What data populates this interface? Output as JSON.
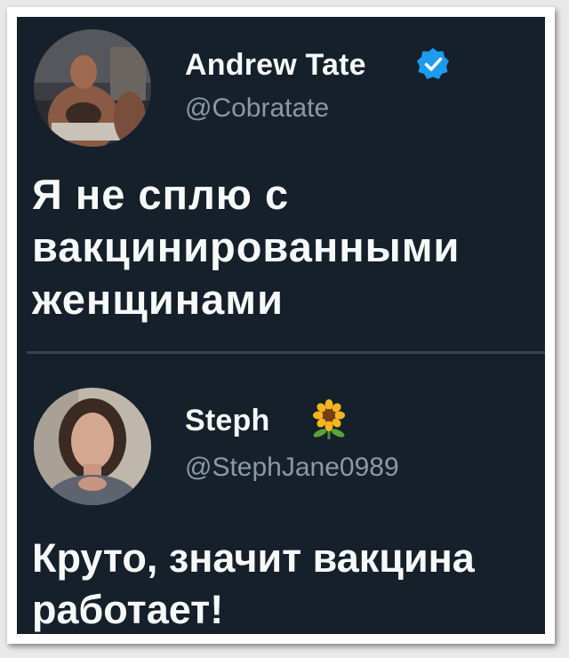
{
  "tweet1": {
    "name": "Andrew Tate",
    "handle": "@Cobratate",
    "verified": true,
    "text": "Я не сплю с вакцинированными женщинами"
  },
  "tweet2": {
    "name": "Steph",
    "name_emoji": "sunflower-icon",
    "handle": "@StephJane0989",
    "text": "Круто, значит вакцина работает!"
  },
  "colors": {
    "background": "#15202b",
    "text": "#f7f9f9",
    "secondary_text": "#8b98a5",
    "verified_badge": "#1d9bf0",
    "divider": "#38444d"
  }
}
